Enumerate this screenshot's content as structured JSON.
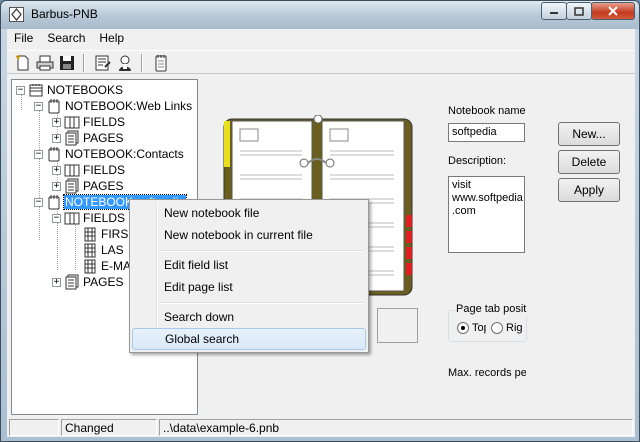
{
  "window": {
    "title": "Barbus-PNB",
    "controls": {
      "minimize": "minimize-icon",
      "maximize": "maximize-icon",
      "close": "close-icon"
    }
  },
  "menubar": {
    "items": [
      {
        "label": "File"
      },
      {
        "label": "Search"
      },
      {
        "label": "Help"
      }
    ]
  },
  "toolbar": {
    "icons": [
      "new-file-icon",
      "print-icon",
      "save-icon",
      "edit-page-icon",
      "user-icon",
      "notebook-icon"
    ]
  },
  "tree": {
    "root": "NOTEBOOKS",
    "nodes": [
      {
        "label": "NOTEBOOKS",
        "expander": "−"
      },
      {
        "label": "NOTEBOOK:Web Links",
        "expander": "−"
      },
      {
        "label": "FIELDS",
        "expander": "+"
      },
      {
        "label": "PAGES",
        "expander": "+"
      },
      {
        "label": "NOTEBOOK:Contacts",
        "expander": "−"
      },
      {
        "label": "FIELDS",
        "expander": "+"
      },
      {
        "label": "PAGES",
        "expander": "+"
      },
      {
        "label": "NOTEBOOK:softpedia",
        "expander": "−",
        "selected": true
      },
      {
        "label": "FIELDS",
        "expander": "−"
      },
      {
        "label": "FIRS",
        "expander": ""
      },
      {
        "label": "LAS",
        "expander": ""
      },
      {
        "label": "E-MA",
        "expander": ""
      },
      {
        "label": "PAGES",
        "expander": "+"
      }
    ]
  },
  "form": {
    "notebook_name_label": "Notebook name",
    "notebook_name_value": "softpedia",
    "description_label": "Description:",
    "description_value": "visit\nwww.softpedia\n.com",
    "page_tab_label": "Page tab position",
    "radio_top": "Top",
    "radio_right": "Right",
    "max_records_label": "Max. records per page"
  },
  "buttons": {
    "new": "New...",
    "delete": "Delete",
    "apply": "Apply"
  },
  "context_menu": {
    "items": [
      "New notebook file",
      "New notebook in current file",
      "Edit field list",
      "Edit page list",
      "Search down",
      "Global search"
    ],
    "highlighted": "Global search"
  },
  "statusbar": {
    "state": "Changed",
    "path": "..\\data\\example-6.pnb"
  },
  "colors": {
    "selection": "#3399ff",
    "notebook_cover": "#6b5f1e",
    "tab_yellow": "#e8e01a",
    "tab_red": "#e02020"
  }
}
